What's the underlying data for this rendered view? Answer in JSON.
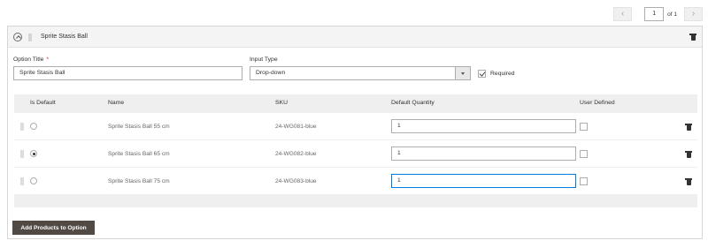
{
  "pager": {
    "prev_icon": "chevron-left-icon",
    "next_icon": "chevron-right-icon",
    "current_page": "1",
    "of_label": "of 1"
  },
  "option": {
    "title": "Sprite Stasis Ball",
    "title_label": "Option Title",
    "required_star": "*",
    "title_value": "Sprite Stasis Ball",
    "input_type_label": "Input Type",
    "input_type_value": "Drop-down",
    "required_label": "Required",
    "required_checked": true
  },
  "table": {
    "headers": [
      "Is Default",
      "Name",
      "SKU",
      "Default Quantity",
      "User Defined"
    ],
    "rows": [
      {
        "is_default": false,
        "name": "Sprite Stasis Ball 55 cm",
        "sku": "24-WG081-blue",
        "qty": "1",
        "user_defined": false
      },
      {
        "is_default": true,
        "name": "Sprite Stasis Ball 65 cm",
        "sku": "24-WG082-blue",
        "qty": "1",
        "user_defined": false
      },
      {
        "is_default": false,
        "name": "Sprite Stasis Ball 75 cm",
        "sku": "24-WG083-blue",
        "qty": "1",
        "user_defined": false
      }
    ]
  },
  "add_button_label": "Add Products to Option"
}
